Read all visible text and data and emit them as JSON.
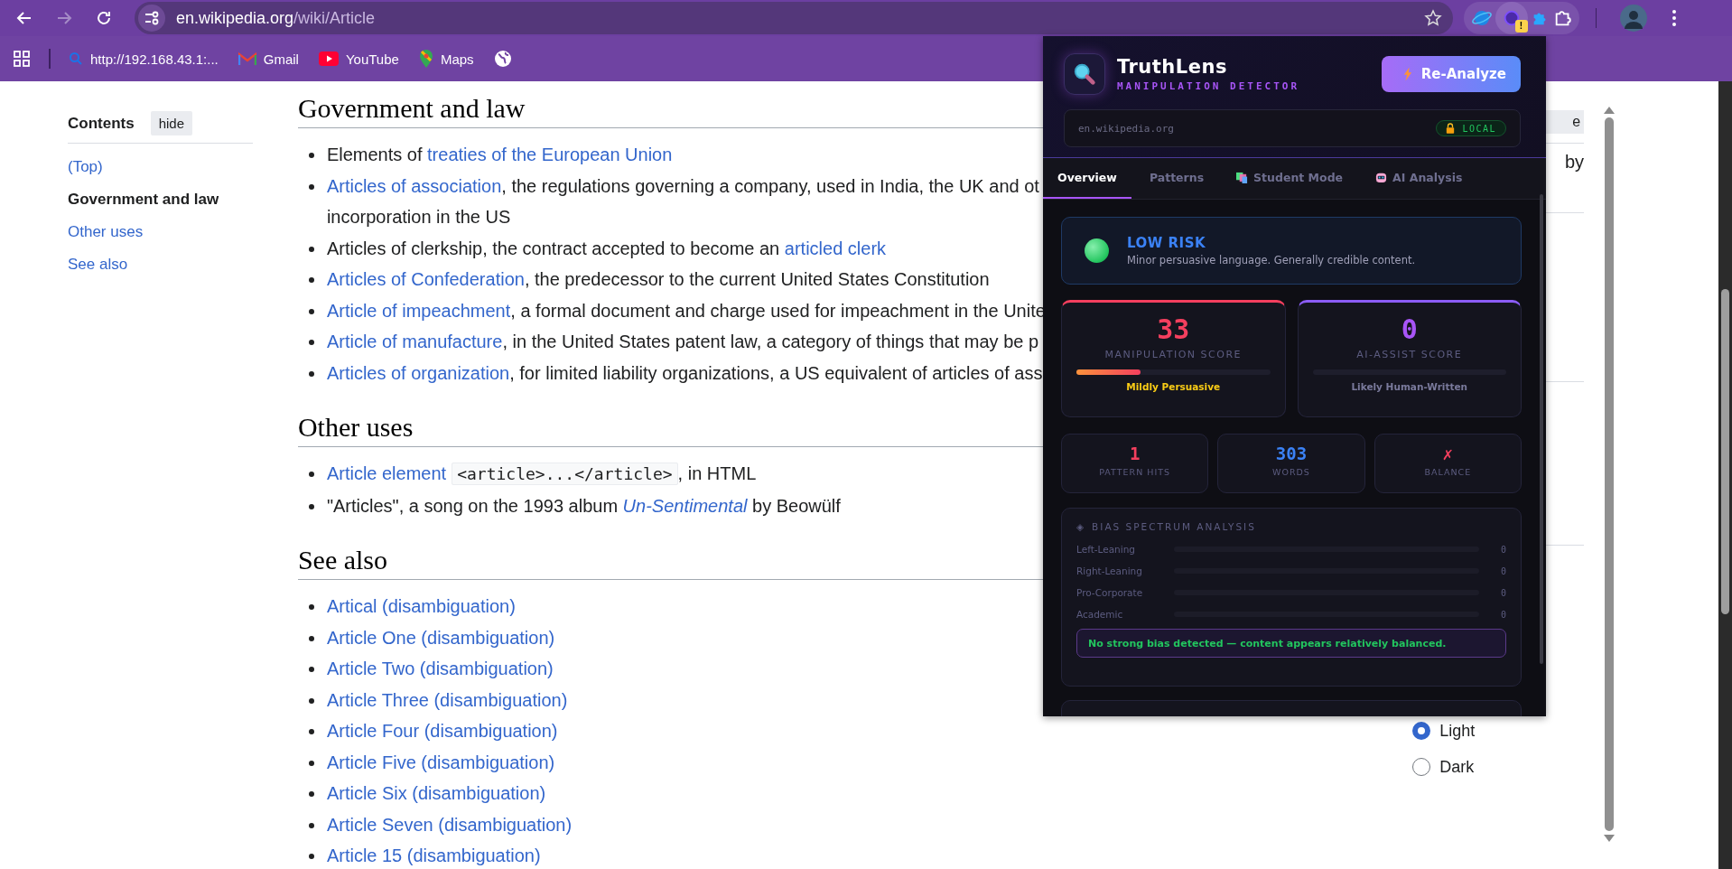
{
  "toolbar": {
    "back": {
      "disabled": false
    },
    "forward": {
      "disabled": true
    },
    "address": {
      "host": "en.wikipedia.org",
      "path": "/wiki/Article"
    },
    "extension_badge": "!"
  },
  "bookmarks": [
    {
      "label": "http://192.168.43.1:...",
      "kind": "search"
    },
    {
      "label": "Gmail",
      "kind": "gmail"
    },
    {
      "label": "YouTube",
      "kind": "youtube"
    },
    {
      "label": "Maps",
      "kind": "maps"
    },
    {
      "kind": "globe"
    }
  ],
  "toc": {
    "title": "Contents",
    "hide_button": "hide",
    "items": [
      {
        "label": "(Top)",
        "selected": false
      },
      {
        "label": "Government and law",
        "selected": true
      },
      {
        "label": "Other uses",
        "selected": false
      },
      {
        "label": "See also",
        "selected": false
      }
    ]
  },
  "sections": [
    {
      "heading": "Government and law",
      "items": [
        {
          "parts": [
            {
              "kind": "text",
              "text": "Elements of "
            },
            {
              "kind": "link",
              "text": "treaties of the European Union"
            }
          ]
        },
        {
          "parts": [
            {
              "kind": "link",
              "text": "Articles of association"
            },
            {
              "kind": "text",
              "text": ", the regulations governing a company, used in India, the UK and ot"
            },
            {
              "kind": "continuation",
              "text": "incorporation in the US"
            }
          ]
        },
        {
          "parts": [
            {
              "kind": "text",
              "text": "Articles of clerkship, the contract accepted to become an "
            },
            {
              "kind": "link",
              "text": "articled clerk"
            }
          ]
        },
        {
          "parts": [
            {
              "kind": "link",
              "text": "Articles of Confederation"
            },
            {
              "kind": "text",
              "text": ", the predecessor to the current United States Constitution"
            }
          ]
        },
        {
          "parts": [
            {
              "kind": "link",
              "text": "Article of impeachment"
            },
            {
              "kind": "text",
              "text": ", a formal document and charge used for impeachment in the Unite"
            }
          ]
        },
        {
          "parts": [
            {
              "kind": "link",
              "text": "Article of manufacture"
            },
            {
              "kind": "text",
              "text": ", in the United States patent law, a category of things that may be p"
            }
          ]
        },
        {
          "parts": [
            {
              "kind": "link",
              "text": "Articles of organization"
            },
            {
              "kind": "text",
              "text": ", for limited liability organizations, a US equivalent of articles of ass"
            }
          ]
        }
      ]
    },
    {
      "heading": "Other uses",
      "items": [
        {
          "parts": [
            {
              "kind": "link",
              "text": "Article element"
            },
            {
              "kind": "code",
              "text": "<article>...</article>"
            },
            {
              "kind": "text",
              "text": ", in HTML"
            }
          ]
        },
        {
          "parts": [
            {
              "kind": "text",
              "text": "\"Articles\", a song on the 1993 album "
            },
            {
              "kind": "italic-link",
              "text": "Un-Sentimental"
            },
            {
              "kind": "text",
              "text": " by Beowülf"
            }
          ]
        }
      ]
    },
    {
      "heading": "See also",
      "items": [
        {
          "parts": [
            {
              "kind": "link",
              "text": "Artical (disambiguation)"
            }
          ]
        },
        {
          "parts": [
            {
              "kind": "link",
              "text": "Article One (disambiguation)"
            }
          ]
        },
        {
          "parts": [
            {
              "kind": "link",
              "text": "Article Two (disambiguation)"
            }
          ]
        },
        {
          "parts": [
            {
              "kind": "link",
              "text": "Article Three (disambiguation)"
            }
          ]
        },
        {
          "parts": [
            {
              "kind": "link",
              "text": "Article Four (disambiguation)"
            }
          ]
        },
        {
          "parts": [
            {
              "kind": "link",
              "text": "Article Five (disambiguation)"
            }
          ]
        },
        {
          "parts": [
            {
              "kind": "link",
              "text": "Article Six (disambiguation)"
            }
          ]
        },
        {
          "parts": [
            {
              "kind": "link",
              "text": "Article Seven (disambiguation)"
            }
          ]
        },
        {
          "parts": [
            {
              "kind": "link",
              "text": "Article 15 (disambiguation)"
            }
          ]
        }
      ]
    }
  ],
  "sidebar": {
    "button_fragment": "e",
    "text_fragment": "by",
    "theme_options": [
      {
        "label": "Light",
        "selected": true
      },
      {
        "label": "Dark",
        "selected": false
      }
    ]
  },
  "popup": {
    "title": "TruthLens",
    "subtitle": "MANIPULATION DETECTOR",
    "reanalyze": "Re-Analyze",
    "url": "en.wikipedia.org",
    "url_badge": "LOCAL",
    "tabs": [
      {
        "label": "Overview",
        "selected": true,
        "kind": "plain"
      },
      {
        "label": "Patterns",
        "selected": false,
        "kind": "plain"
      },
      {
        "label": "Student Mode",
        "selected": false,
        "kind": "student"
      },
      {
        "label": "AI Analysis",
        "selected": false,
        "kind": "robot"
      }
    ],
    "risk": {
      "label": "LOW RISK",
      "description": "Minor persuasive language. Generally credible content."
    },
    "scores": [
      {
        "value": "33",
        "label": "MANIPULATION SCORE",
        "level": 0.33,
        "verdict": "Mildly Persuasive",
        "kind": "manipulation"
      },
      {
        "value": "0",
        "label": "AI-ASSIST SCORE",
        "verdict": "Likely Human-Written",
        "kind": "ai"
      }
    ],
    "stats": [
      {
        "value": "1",
        "label": "PATTERN HITS",
        "kind": "danger"
      },
      {
        "value": "303",
        "label": "WORDS",
        "kind": "info"
      },
      {
        "value": "✗",
        "label": "BALANCE",
        "kind": "danger"
      }
    ],
    "bias": {
      "icon": "◈",
      "title": "BIAS SPECTRUM ANALYSIS",
      "rows": [
        {
          "label": "Left-Leaning",
          "value": "0"
        },
        {
          "label": "Right-Leaning",
          "value": "0"
        },
        {
          "label": "Pro-Corporate",
          "value": "0"
        },
        {
          "label": "Academic",
          "value": "0"
        }
      ],
      "notice": "No strong bias detected — content appears relatively balanced."
    }
  }
}
